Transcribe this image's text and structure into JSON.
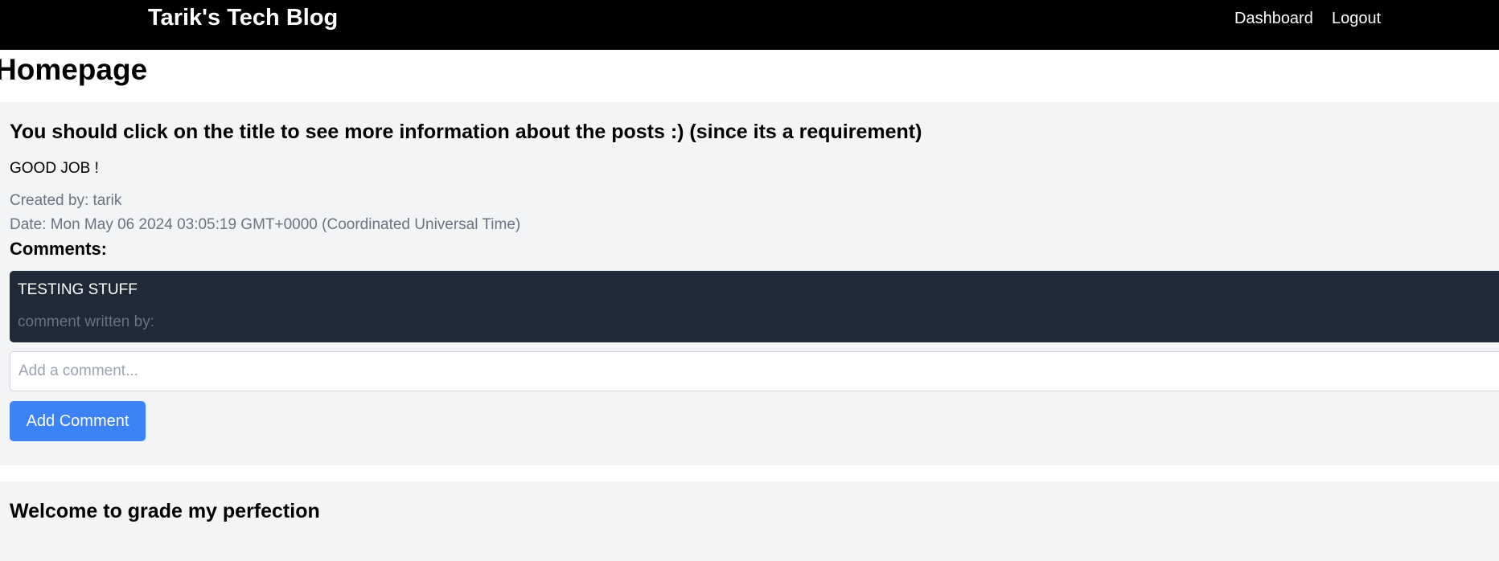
{
  "header": {
    "brand": "Tarik's Tech Blog",
    "nav": {
      "dashboard": "Dashboard",
      "logout": "Logout"
    }
  },
  "page": {
    "title": "Homepage"
  },
  "posts": [
    {
      "title": "You should click on the title to see more information about the posts :) (since its a requirement)",
      "body": "GOOD JOB !",
      "created_by": "Created by: tarik",
      "date": "Date: Mon May 06 2024 03:05:19 GMT+0000 (Coordinated Universal Time)",
      "comments_heading": "Comments:",
      "comments": [
        {
          "text": "TESTING STUFF",
          "author": "comment written by:"
        }
      ],
      "comment_input": {
        "value": "",
        "placeholder": "Add a comment..."
      },
      "add_comment_label": "Add Comment"
    },
    {
      "title": "Welcome to grade my perfection"
    }
  ],
  "colors": {
    "navbar": "#000000",
    "post_background": "#f3f4f6",
    "comment_card": "#1f2937",
    "button": "#3b82f6",
    "muted_text": "#6b7280"
  }
}
